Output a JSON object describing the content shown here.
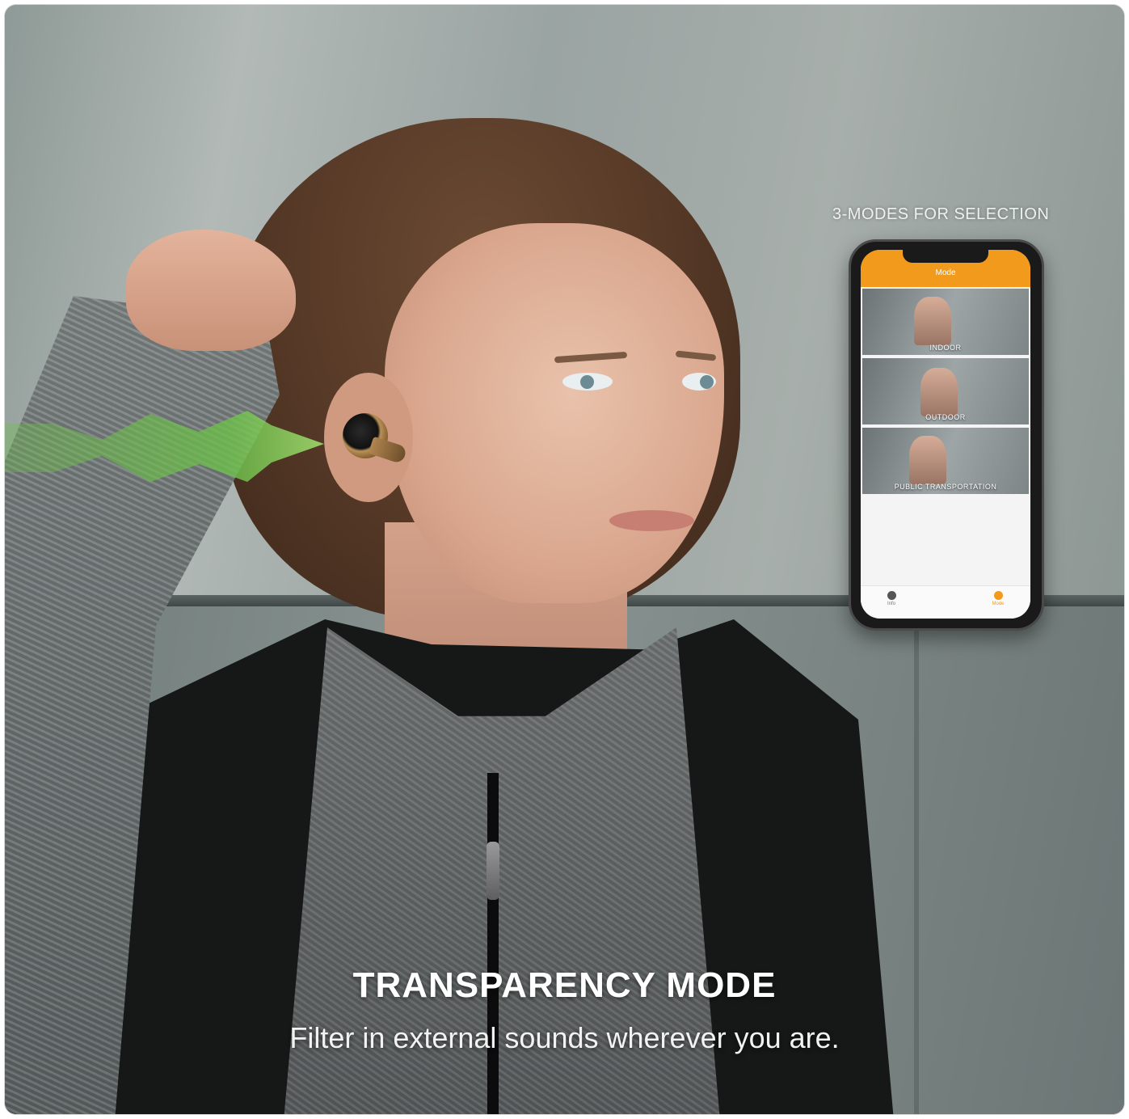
{
  "caption": {
    "modes": "3-MODES FOR SELECTION"
  },
  "headline": "TRANSPARENCY MODE",
  "subline": "Filter in external sounds wherever you are.",
  "phone": {
    "header_title": "Mode",
    "modes": [
      {
        "label": "INDOOR"
      },
      {
        "label": "OUTDOOR"
      },
      {
        "label": "PUBLIC TRANSPORTATION"
      }
    ],
    "tabs": [
      {
        "label": "Info"
      },
      {
        "label": "Mode"
      }
    ],
    "accent_color": "#f29a1b"
  },
  "wave_color": "#6cc04a",
  "icons": [
    "info-icon",
    "mode-icon",
    "earbud-icon",
    "sound-wave-icon"
  ]
}
